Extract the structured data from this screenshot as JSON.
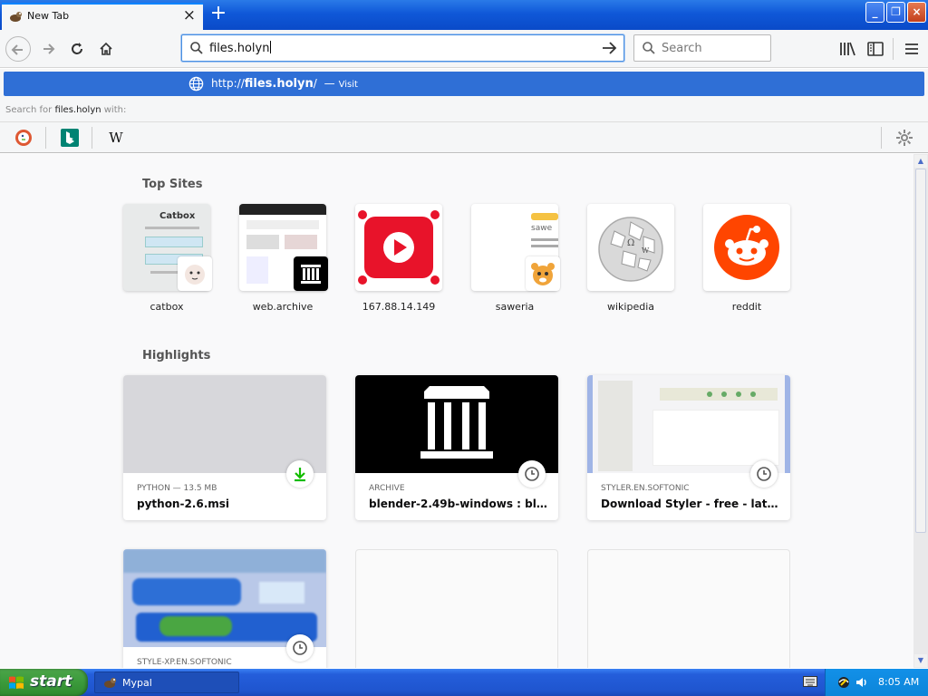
{
  "tab": {
    "title": "New Tab",
    "close": "×",
    "new_tab": "+"
  },
  "window": {
    "minimize": "_",
    "restore": "❐",
    "close": "×"
  },
  "navbar": {
    "url_value": "files.holyn",
    "search_placeholder": "Search"
  },
  "dropdown": {
    "suggestion": {
      "prefix": "http://",
      "host": "files.holyn",
      "suffix": "/",
      "dash": "—",
      "action": "Visit"
    },
    "search_for_prefix": "Search for ",
    "search_for_term": "files.holyn",
    "search_for_suffix": " with:",
    "engines": [
      "DuckDuckGo",
      "Bing",
      "Wikipedia"
    ],
    "wiki_glyph": "W"
  },
  "top_sites": {
    "heading": "Top Sites",
    "items": [
      {
        "label": "catbox"
      },
      {
        "label": "web.archive"
      },
      {
        "label": "167.88.14.149"
      },
      {
        "label": "saweria"
      },
      {
        "label": "wikipedia"
      },
      {
        "label": "reddit"
      }
    ]
  },
  "highlights": {
    "heading": "Highlights",
    "cards": [
      {
        "meta": "PYTHON — 13.5 MB",
        "title": "python-2.6.msi",
        "context_icon": "download-icon"
      },
      {
        "meta": "ARCHIVE",
        "title": "blender-2.49b-windows : blende…",
        "context_icon": "clock-icon"
      },
      {
        "meta": "STYLER.EN.SOFTONIC",
        "title": "Download Styler - free - latest v…",
        "context_icon": "clock-icon"
      },
      {
        "meta": "STYLE-XP.EN.SOFTONIC",
        "title": "",
        "context_icon": "clock-icon"
      }
    ]
  },
  "taskbar": {
    "start_label": "start",
    "task_label": "Mypal",
    "time": "8:05 AM"
  },
  "colors": {
    "accent": "#0a84ff",
    "suggest_bg": "#2f6fd6",
    "reddit": "#ff4500",
    "youtube_red": "#e8132a",
    "xp_green": "#3b9a3b"
  }
}
